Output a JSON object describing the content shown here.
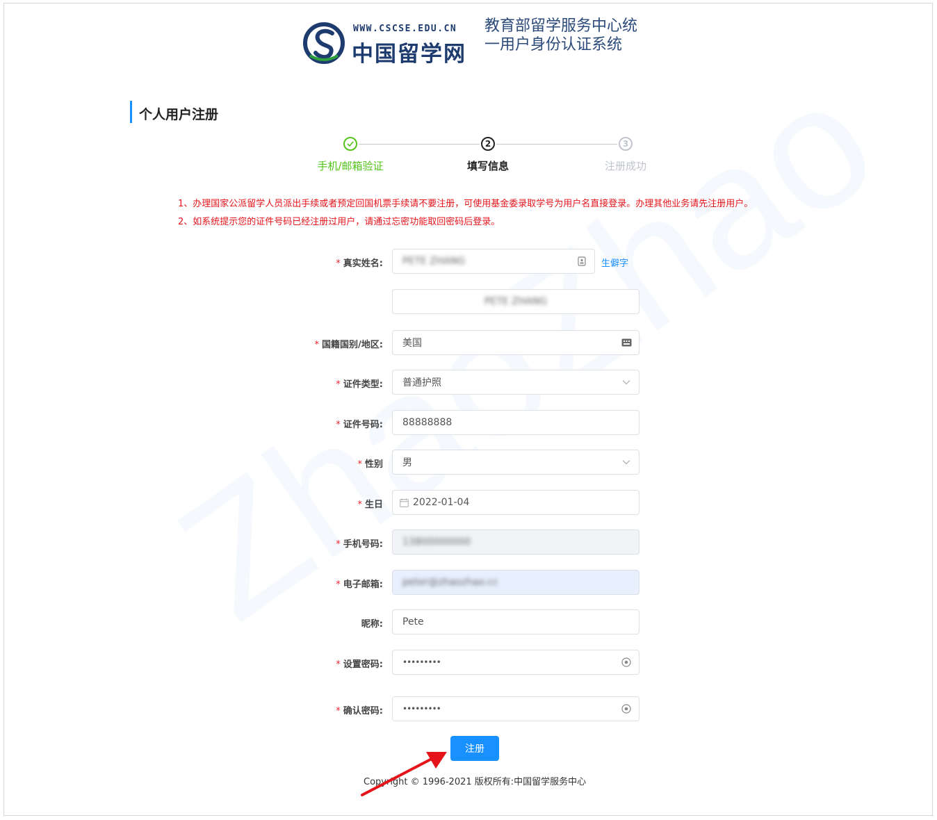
{
  "header": {
    "logo_url_text": "WWW.CSCSE.EDU.CN",
    "logo_cn_text": "中国留学网",
    "system_title": "教育部留学服务中心统一用户身份认证系统"
  },
  "section_title": "个人用户注册",
  "steps": [
    {
      "number": "1",
      "label": "手机/邮箱验证",
      "state": "done"
    },
    {
      "number": "2",
      "label": "填写信息",
      "state": "current"
    },
    {
      "number": "3",
      "label": "注册成功",
      "state": "pending"
    }
  ],
  "notices": [
    "1、办理国家公派留学人员派出手续或者预定回国机票手续请不要注册，可使用基金委录取学号为用户名直接登录。办理其他业务请先注册用户。",
    "2、如系统提示您的证件号码已经注册过用户，请通过忘密功能取回密码后登录。"
  ],
  "form": {
    "real_name": {
      "label": "真实姓名:",
      "value": "PETE ZHANG",
      "rare_char_link": "生僻字"
    },
    "name_preview": {
      "value": "PETE ZHANG"
    },
    "nationality": {
      "label": "国籍国别/地区:",
      "value": "美国"
    },
    "id_type": {
      "label": "证件类型:",
      "value": "普通护照"
    },
    "id_number": {
      "label": "证件号码:",
      "value": "88888888"
    },
    "gender": {
      "label": "性别",
      "value": "男"
    },
    "birthday": {
      "label": "生日",
      "value": "2022-01-04"
    },
    "phone": {
      "label": "手机号码:",
      "value": "13800000000"
    },
    "email": {
      "label": "电子邮箱:",
      "value": "peter@zhaozhao.cc"
    },
    "nickname": {
      "label": "昵称:",
      "value": "Pete"
    },
    "password": {
      "label": "设置密码:",
      "value": "•••••••••"
    },
    "confirm_password": {
      "label": "确认密码:",
      "value": "•••••••••"
    },
    "required_mark": "*"
  },
  "submit_label": "注册",
  "footer": "Copyright © 1996-2021 版权所有:中国留学服务中心",
  "watermark_text": "ZhaoZhao",
  "colors": {
    "accent": "#1890ff",
    "success": "#52c41a",
    "notice": "#e5141b",
    "brand": "#1d3b6e"
  }
}
